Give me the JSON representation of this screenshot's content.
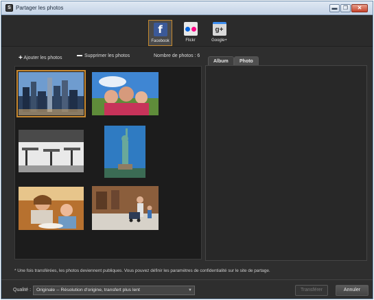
{
  "window": {
    "title": "Partager les photos",
    "controls": {
      "minimize": "▬",
      "maximize": "❐",
      "close": "✕"
    }
  },
  "services": [
    {
      "name": "Facebook",
      "icon": "facebook-icon",
      "active": true
    },
    {
      "name": "Flickr",
      "icon": "flickr-icon",
      "active": false
    },
    {
      "name": "Google+",
      "icon": "google-plus-icon",
      "active": false
    }
  ],
  "toolbar": {
    "add_label": "Ajouter les photos",
    "remove_label": "Supprimer les photos",
    "count_label": "Nombre de photos : 6"
  },
  "photos": [
    {
      "subject": "city-skyline",
      "selected": true
    },
    {
      "subject": "family-on-grass",
      "selected": false
    },
    {
      "subject": "cafe-tables",
      "selected": false
    },
    {
      "subject": "statue-of-liberty",
      "selected": false
    },
    {
      "subject": "mother-child-meal",
      "selected": false
    },
    {
      "subject": "street-stroller",
      "selected": false
    }
  ],
  "tabs": {
    "album": "Album",
    "photo": "Photo"
  },
  "footnote": "* Une fois transférées, les photos deviennent publiques. Vous pouvez définir les paramètres de confidentialité sur le site de partage.",
  "footer": {
    "quality_label": "Qualité :",
    "quality_value": "Originale -- Résolution d'origine, transfert plus lent",
    "transfer_label": "Transférer",
    "cancel_label": "Annuler"
  },
  "colors": {
    "accent": "#c98a31",
    "facebook": "#3b5998",
    "background": "#2e2e2e"
  }
}
